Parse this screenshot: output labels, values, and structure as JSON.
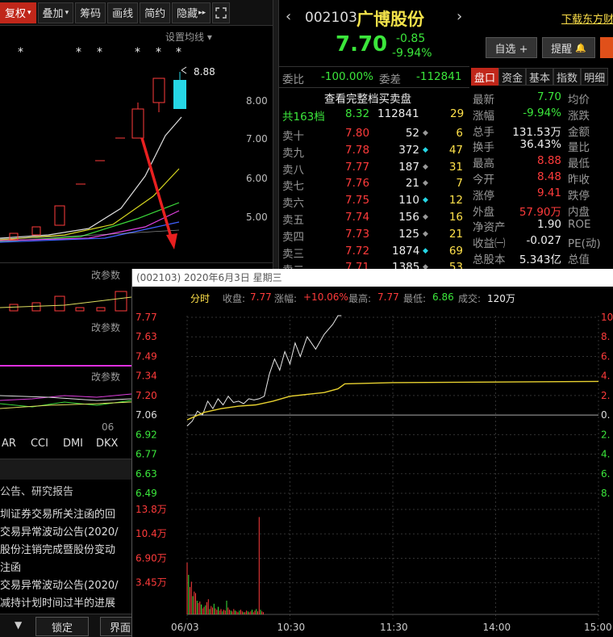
{
  "toolbar": {
    "items": [
      "复权",
      "叠加",
      "筹码",
      "画线",
      "简约",
      "隐藏"
    ],
    "expand_arrow": "▸▸",
    "fullscreen_icon": "fullscreen-icon"
  },
  "kline": {
    "ma_setting": "设置均线 ▾",
    "peak_price": "8.88",
    "price_ticks": [
      "8.00",
      "7.00",
      "6.00",
      "5.00"
    ],
    "stars": [
      "*",
      "*",
      "*",
      "*",
      "*",
      "*"
    ],
    "param_label": "改参数",
    "date_label": "06",
    "indicators": [
      "AR",
      "CCI",
      "DMI",
      "DKX"
    ]
  },
  "news": {
    "header": "公告、研究报告",
    "items": [
      "圳证券交易所关注函的回",
      "交易异常波动公告(2020/",
      "股份注销完成暨股份变动",
      "注函",
      "交易异常波动公告(2020/",
      "减持计划时间过半的进展"
    ]
  },
  "bottom_buttons": {
    "lock": "锁定",
    "interface": "界面"
  },
  "stock": {
    "code": "002103",
    "name": "广博股份",
    "price": "7.70",
    "change": "-0.85",
    "change_pct": "-9.94%",
    "download_link": "下载东方财",
    "watch_btn": "自选 +",
    "alert_btn": "提醒"
  },
  "order_book": {
    "weibi_label": "委比",
    "weibi_value": "-100.00%",
    "weicha_label": "委差",
    "weicha_value": "-112841",
    "full_book_link": "查看完整档买卖盘",
    "total_label": "共163档",
    "total_price": "8.32",
    "total_volume": "112841",
    "total_count": "29",
    "levels": [
      {
        "label": "卖十",
        "price": "7.80",
        "volume": "52",
        "count": "6",
        "marker": "◆"
      },
      {
        "label": "卖九",
        "price": "7.78",
        "volume": "372",
        "count": "47",
        "marker": "◆"
      },
      {
        "label": "卖八",
        "price": "7.77",
        "volume": "187",
        "count": "31",
        "marker": "◆"
      },
      {
        "label": "卖七",
        "price": "7.76",
        "volume": "21",
        "count": "7",
        "marker": "◆"
      },
      {
        "label": "卖六",
        "price": "7.75",
        "volume": "110",
        "count": "12",
        "marker": "◆"
      },
      {
        "label": "卖五",
        "price": "7.74",
        "volume": "156",
        "count": "16",
        "marker": "◆"
      },
      {
        "label": "卖四",
        "price": "7.73",
        "volume": "125",
        "count": "21",
        "marker": "◆"
      },
      {
        "label": "卖三",
        "price": "7.72",
        "volume": "1874",
        "count": "69",
        "marker": "◆"
      },
      {
        "label": "卖二",
        "price": "7.71",
        "volume": "1385",
        "count": "53",
        "marker": "◆"
      }
    ]
  },
  "quote_tabs": [
    "盘口",
    "资金",
    "基本",
    "指数",
    "明细"
  ],
  "quote": {
    "rows": [
      {
        "label": "最新",
        "value": "7.70",
        "label2": "均价"
      },
      {
        "label": "涨幅",
        "value": "-9.94%",
        "label2": "涨跌"
      },
      {
        "label": "总手",
        "value": "131.53万",
        "label2": "金额"
      },
      {
        "label": "换手",
        "value": "36.43%",
        "label2": "量比"
      },
      {
        "label": "最高",
        "value": "8.88",
        "label2": "最低"
      },
      {
        "label": "今开",
        "value": "8.48",
        "label2": "昨收"
      },
      {
        "label": "涨停",
        "value": "9.41",
        "label2": "跌停"
      },
      {
        "label": "外盘",
        "value": "57.90万",
        "label2": "内盘"
      },
      {
        "label": "净资产",
        "value": "1.90",
        "label2": "ROE"
      },
      {
        "label": "收益㈠",
        "value": "-0.027",
        "label2": "PE(动)"
      },
      {
        "label": "总股本",
        "value": "5.343亿",
        "label2": "总值"
      }
    ]
  },
  "popup": {
    "title": "(002103) 2020年6月3日 星期三",
    "fenshi": "分时",
    "close_label": "收盘:",
    "close_value": "7.77",
    "change_label": "涨幅:",
    "change_value": "+10.06%",
    "high_label": "最高:",
    "high_value": "7.77",
    "low_label": "最低:",
    "low_value": "6.86",
    "turnover_label": "成交:",
    "turnover_value": "120万"
  },
  "colors": {
    "up": "#ff3b3b",
    "down": "#3be63b",
    "accent": "#c0271a",
    "avg": "#e8d230",
    "cyan": "#26d7e6"
  },
  "chart_data": [
    {
      "type": "line",
      "title": "",
      "price_ticks_left": [
        "7.77",
        "7.63",
        "7.49",
        "7.34",
        "7.20",
        "7.06",
        "6.92",
        "6.77",
        "6.63",
        "6.49"
      ],
      "pct_ticks_right": [
        "10.",
        "8.",
        "6.",
        "4.",
        "2.",
        "0.",
        "2.",
        "4.",
        "6.",
        "8."
      ],
      "x_ticks": [
        "06/03",
        "10:30",
        "11:30",
        "14:00",
        "15:00"
      ],
      "ylim": [
        6.35,
        7.77
      ],
      "series": [
        {
          "values_x": [
            0,
            3,
            6,
            9,
            12,
            15,
            18,
            21,
            24,
            27,
            30,
            33,
            36,
            39,
            42,
            45,
            48,
            51,
            54,
            57,
            60,
            63,
            66,
            70,
            75,
            80,
            85,
            88,
            90
          ],
          "values": [
            6.88,
            6.92,
            7.0,
            6.97,
            7.08,
            7.02,
            7.1,
            7.05,
            7.12,
            7.07,
            7.08,
            7.06,
            7.1,
            7.09,
            7.1,
            7.12,
            7.3,
            7.42,
            7.33,
            7.48,
            7.38,
            7.55,
            7.44,
            7.6,
            7.5,
            7.62,
            7.7,
            7.77,
            7.77
          ]
        },
        {
          "values_x": [
            0,
            10,
            20,
            30,
            40,
            50,
            60,
            80,
            88,
            92,
            120,
            240
          ],
          "values": [
            6.93,
            6.99,
            7.02,
            7.04,
            7.05,
            7.08,
            7.12,
            7.15,
            7.18,
            7.22,
            7.23,
            7.24
          ]
        }
      ]
    },
    {
      "type": "bar",
      "title": "",
      "y_ticks": [
        "13.8万",
        "10.4万",
        "6.90万",
        "3.45万"
      ],
      "ylim": [
        0,
        13.8
      ],
      "values": [
        6.8,
        5.2,
        3.6,
        4.3,
        2.4,
        3.0,
        2.8,
        1.8,
        1.5,
        1.7,
        1.3,
        0.8,
        1.0,
        1.2,
        1.6,
        2.0,
        0.7,
        1.1,
        0.9,
        1.4,
        0.8,
        0.6,
        1.0,
        0.5,
        0.7,
        0.4,
        0.6,
        0.5,
        1.8,
        0.9,
        0.6,
        0.5,
        0.4,
        0.7,
        0.5,
        0.4,
        0.3,
        0.5,
        0.6,
        0.4,
        0.3,
        0.3,
        0.5,
        0.4,
        0.3,
        0.4,
        0.6,
        0.3,
        0.5,
        0.7,
        0.4,
        12.8,
        0.6,
        0.4,
        0.3
      ]
    }
  ]
}
